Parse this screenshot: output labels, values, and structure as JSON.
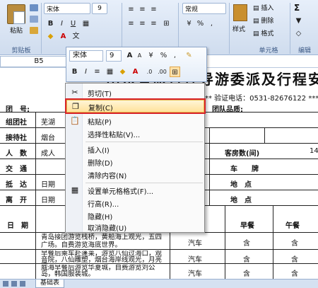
{
  "ribbon": {
    "font_name": "宋体",
    "font_size": "9",
    "number_format": "常规",
    "paste_label": "粘贴",
    "style_label": "样式",
    "insert_label": "插入",
    "delete_label": "删除",
    "format_label": "格式",
    "sigma": "Σ",
    "group_clipboard": "剪贴板",
    "group_cells": "单元格",
    "group_edit": "编辑"
  },
  "formula_bar": {
    "cell_ref": "B5"
  },
  "sheet": {
    "title": "山东省旅行社导游委派及行程安",
    "verify_line": "** 验证电话：0531-82676122 ***",
    "rows": {
      "group_no": "团　号:",
      "group_quality": "团队品质:",
      "organizer": "组团社",
      "organizer_val": "芜湖",
      "receiver": "接待社",
      "receiver_val": "烟台",
      "people": "人　数",
      "people_val": "成人",
      "guests_room": "客房数(间)",
      "guests_room_val": "14",
      "transport": "交　通",
      "vehicle": "车　　牌",
      "arrive": "抵　达",
      "arrive_val": "日期",
      "arrive_place": "地　点",
      "leave": "离　开",
      "leave_val": "日期",
      "leave_place": "地　点",
      "date_col": "日　期",
      "breakfast": "早餐",
      "lunch": "午餐"
    },
    "itinerary": [
      {
        "text": "青岛接团游览栈桥，黄船海上观光，五四广场。自费游览海底世界。",
        "transport": "",
        "breakfast": "",
        "lunch": ""
      },
      {
        "text": "早餐后乘车赴蓬莱，游览八仙过海口，观音院，八仙雕塑，烟台海岸线观光，月亮湾。",
        "transport": "汽车",
        "breakfast": "含",
        "lunch": "含"
      },
      {
        "text": "威海早餐后游览华夏城，自费游览刘公岛，韩国服装城。",
        "transport": "汽车",
        "breakfast": "含",
        "lunch": "含"
      }
    ],
    "itinerary_extra_transport": "汽车",
    "itinerary_extra_meal_b": "含",
    "itinerary_extra_meal_l": "含"
  },
  "tabbar": {
    "sheet_name": "基础表"
  },
  "mini_toolbar": {
    "font_name": "宋体",
    "font_size": "9",
    "currency": "%",
    "comma": ","
  },
  "context_menu": {
    "items": [
      {
        "label": "剪切(T)",
        "icon": "scissors-icon"
      },
      {
        "label": "复制(C)",
        "icon": "copy-icon"
      },
      {
        "label": "粘贴(P)",
        "icon": "paste-icon"
      },
      {
        "label": "选择性粘贴(V)...",
        "icon": ""
      },
      {
        "label": "插入(I)",
        "icon": ""
      },
      {
        "label": "删除(D)",
        "icon": ""
      },
      {
        "label": "清除内容(N)",
        "icon": ""
      },
      {
        "label": "设置单元格格式(F)...",
        "icon": "format-cells-icon"
      },
      {
        "label": "行高(R)...",
        "icon": ""
      },
      {
        "label": "隐藏(H)",
        "icon": ""
      },
      {
        "label": "取消隐藏(U)",
        "icon": ""
      }
    ],
    "highlight_color": "#d8232a"
  }
}
